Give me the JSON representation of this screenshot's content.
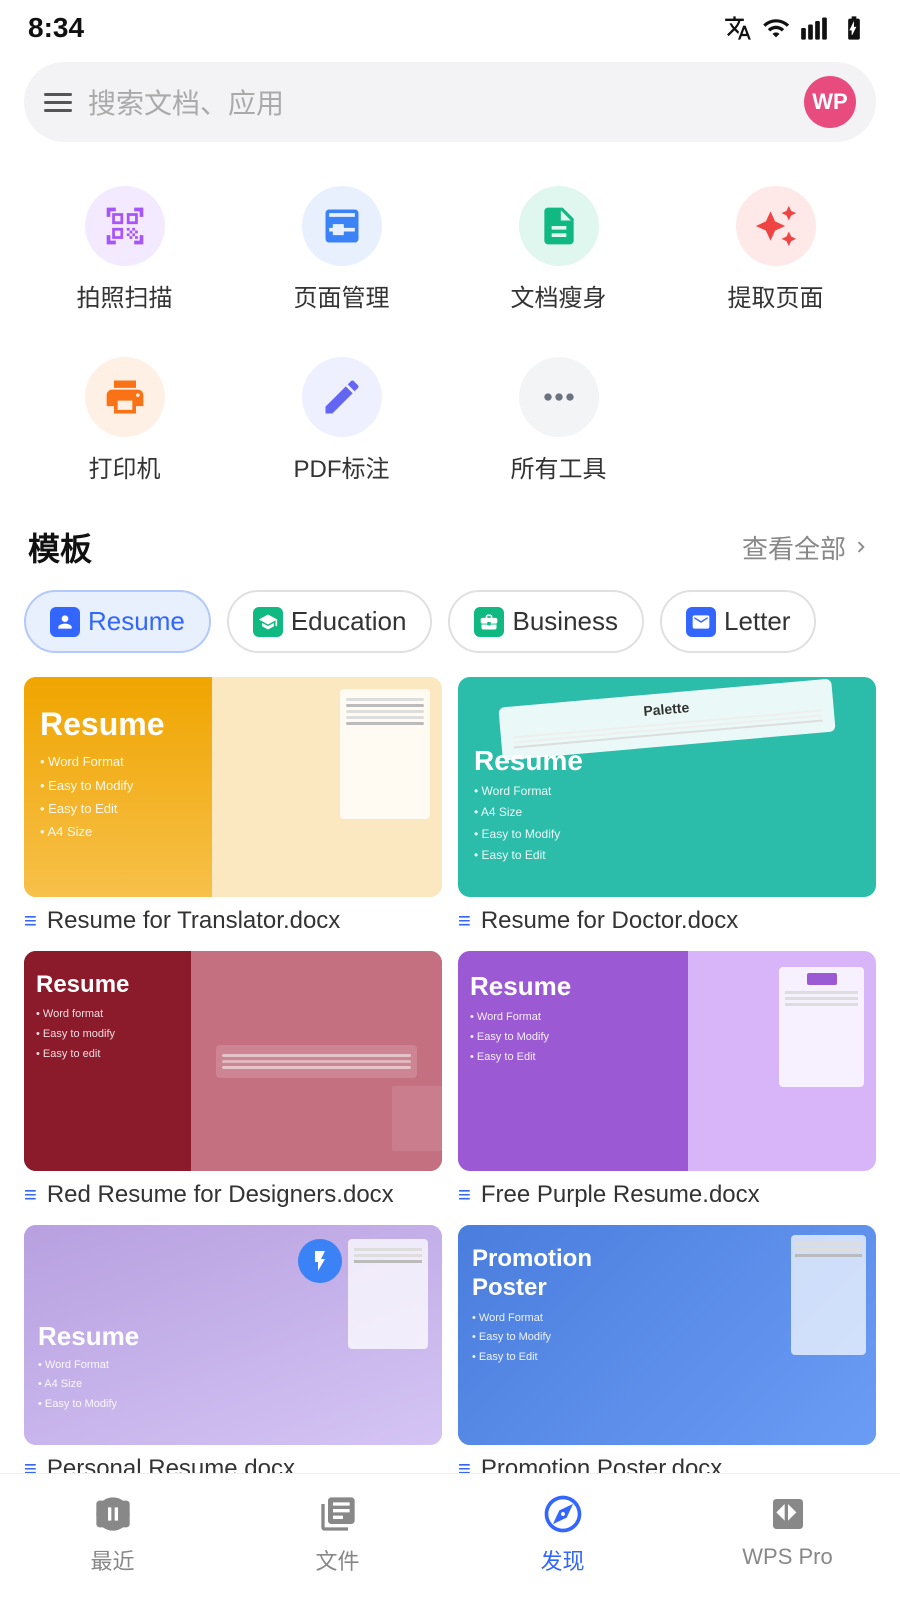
{
  "statusBar": {
    "time": "8:34",
    "avatarText": "WP"
  },
  "searchBar": {
    "placeholder": "搜索文档、应用"
  },
  "tools": {
    "row1": [
      {
        "id": "scan",
        "label": "拍照扫描",
        "iconColor": "#a855f7",
        "bgColor": "#f3eaff"
      },
      {
        "id": "pageManage",
        "label": "页面管理",
        "iconColor": "#3b82f6",
        "bgColor": "#e8f0fe"
      },
      {
        "id": "docSlim",
        "label": "文档瘦身",
        "iconColor": "#10b981",
        "bgColor": "#e0f7f0"
      },
      {
        "id": "extractPage",
        "label": "提取页面",
        "iconColor": "#ef4444",
        "bgColor": "#fee8e8"
      }
    ],
    "row2": [
      {
        "id": "printer",
        "label": "打印机",
        "iconColor": "#f97316",
        "bgColor": "#fff0e6"
      },
      {
        "id": "pdfAnnotate",
        "label": "PDF标注",
        "iconColor": "#6366f1",
        "bgColor": "#eef0ff"
      },
      {
        "id": "allTools",
        "label": "所有工具",
        "iconColor": "#6b7280",
        "bgColor": "#f3f4f6"
      }
    ]
  },
  "templates": {
    "sectionTitle": "模板",
    "viewAll": "查看全部",
    "categories": [
      {
        "id": "resume",
        "label": "Resume",
        "active": true,
        "iconColor": "#3366ff",
        "iconBg": "#e8f0fe"
      },
      {
        "id": "education",
        "label": "Education",
        "active": false,
        "iconColor": "#10b981",
        "iconBg": "#e0f7f0"
      },
      {
        "id": "business",
        "label": "Business",
        "active": false,
        "iconColor": "#10b981",
        "iconBg": "#e0f7f0"
      },
      {
        "id": "letter",
        "label": "Letter",
        "active": false,
        "iconColor": "#3366ff",
        "iconBg": "#e8f0fe"
      }
    ],
    "items": [
      {
        "id": "t1",
        "name": "Resume for Translator.docx",
        "thumbClass": "thumb-1",
        "thumbTitle": "Resume",
        "thumbBullets": "• Word Format\n• Easy to Modify\n• Easy to Edit\n• A4 Size"
      },
      {
        "id": "t2",
        "name": "Resume for Doctor.docx",
        "thumbClass": "thumb-2",
        "thumbTitle": "Resume",
        "thumbBullets": "• Word Format\n• A4 Size\n• Easy to Modify\n• Easy to Edit"
      },
      {
        "id": "t3",
        "name": "Red Resume for Designers.docx",
        "thumbClass": "thumb-3",
        "thumbTitle": "Resume",
        "thumbBullets": "• Word format\n• Easy to modify\n• Easy to edit"
      },
      {
        "id": "t4",
        "name": "Free Purple Resume.docx",
        "thumbClass": "thumb-4",
        "thumbTitle": "Resume",
        "thumbBullets": "• Word Format\n• Easy to Modify\n• Easy to Edit"
      },
      {
        "id": "t5",
        "name": "Personal Resume.docx",
        "thumbClass": "thumb-5",
        "thumbTitle": "Resume",
        "thumbBullets": "• Word Format\n• A4 Size\n• Easy to Modify",
        "hasBadge": true
      },
      {
        "id": "t6",
        "name": "Promotion Poster.docx",
        "thumbClass": "thumb-6",
        "thumbTitle": "Promotion\nPoster",
        "thumbBullets": "• Word Format\n• Easy to Modify\n• Easy to Edit"
      }
    ]
  },
  "bottomNav": [
    {
      "id": "recent",
      "label": "最近",
      "active": false
    },
    {
      "id": "files",
      "label": "文件",
      "active": false
    },
    {
      "id": "discover",
      "label": "发现",
      "active": true
    },
    {
      "id": "wpspro",
      "label": "WPS Pro",
      "active": false
    }
  ]
}
